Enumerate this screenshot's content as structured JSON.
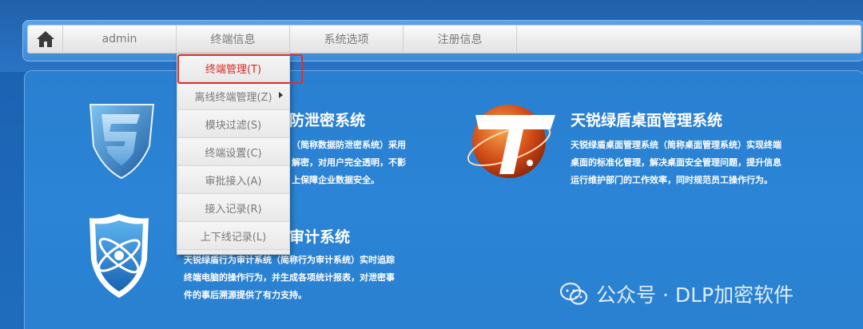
{
  "nav": {
    "home_icon": "home-icon",
    "items": [
      {
        "label": "admin"
      },
      {
        "label": "终端信息"
      },
      {
        "label": "系统选项"
      },
      {
        "label": "注册信息"
      }
    ]
  },
  "menu": {
    "items": [
      {
        "label": "终端管理(T)",
        "active": true
      },
      {
        "label": "离线终端管理(Z)",
        "has_submenu": true
      },
      {
        "label": "模块过滤(S)"
      },
      {
        "label": "终端设置(C)"
      },
      {
        "label": "审批接入(A)"
      },
      {
        "label": "接入记录(R)"
      },
      {
        "label": "上下线记录(L)"
      }
    ]
  },
  "products": {
    "dlp": {
      "title_visible": "防泄密系统",
      "desc_lines": [
        "（简称数据防泄密系统）采用",
        "解密，对用户完全透明，不影",
        "上保障企业数据安全。"
      ]
    },
    "desktop": {
      "title": "天锐绿盾桌面管理系统",
      "desc_lines": [
        "天锐绿盾桌面管理系统（简称桌面管理系统）实现终端",
        "桌面的标准化管理，解决桌面安全管理问题，提升信息",
        "运行维护部门的工作效率，同时规范员工操作行为。"
      ]
    },
    "audit": {
      "title_visible": "审计系统",
      "desc_lines": [
        "天锐绿盾行为审计系统（简称行为审计系统）实时追踪",
        "终端电脑的操作行为，并生成各项统计报表，对泄密事",
        "件的事后溯源提供了有力支持。"
      ]
    }
  },
  "watermark": {
    "text": "公众号 · DLP加密软件"
  },
  "colors": {
    "active_menu": "#d9281f",
    "highlight_border": "#e0302a",
    "background": "#2a7fd0"
  }
}
